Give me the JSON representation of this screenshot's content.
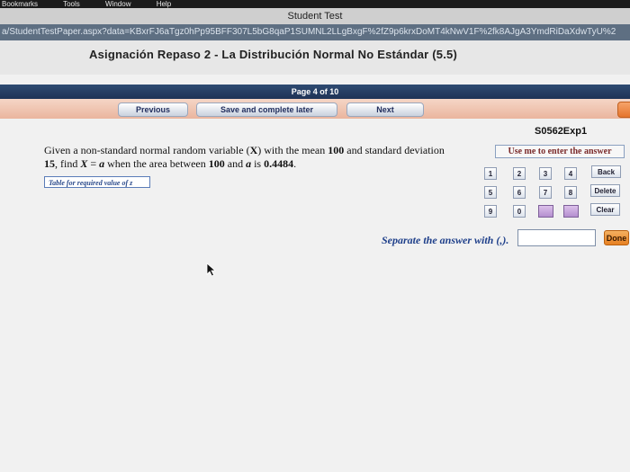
{
  "menubar": {
    "items": [
      "Bookmarks",
      "Tools",
      "Window",
      "Help"
    ]
  },
  "window": {
    "title": "Student Test"
  },
  "url": {
    "text": "a/StudentTestPaper.aspx?data=KBxrFJ6aTgz0hPp95BFF307L5bG8qaP1SUMNL2LLgBxgF%2fZ9p6krxDoMT4kNwV1F%2fk8AJgA3YmdRiDaXdwTyU%2"
  },
  "assignment": {
    "title": "Asignación Repaso 2 - La Distribución Normal No Estándar (5.5)"
  },
  "pager": {
    "label": "Page 4 of 10"
  },
  "nav": {
    "previous": "Previous",
    "save_later": "Save and complete later",
    "next": "Next"
  },
  "question": {
    "id": "S0562Exp1",
    "p1": "Given a non-standard normal random variable (",
    "var_x": "X",
    "p2": ") with the mean ",
    "mean": "100",
    "p3": " and standard deviation ",
    "sd": "15",
    "p4": ", find ",
    "eq_x": "X",
    "eq": " = ",
    "eq_a": "a",
    "p5": " when the area between ",
    "lower": "100",
    "p6": " and ",
    "var_a": "a",
    "p7": " is ",
    "area": "0.4484",
    "p8": ".",
    "table_link": "Table for required value of z"
  },
  "keypad": {
    "header": "Use me to enter the answer",
    "row1": [
      "1",
      "2",
      "3",
      "4"
    ],
    "row2": [
      "5",
      "6",
      "7",
      "8"
    ],
    "row3": [
      "9",
      "0"
    ],
    "back": "Back",
    "delete": "Delete",
    "clear": "Clear"
  },
  "answer": {
    "label": "Separate the answer with (,).",
    "value": "",
    "done": "Done"
  },
  "colors": {
    "pager_bar": "#24395e",
    "nav_row": "#eab59e",
    "done_button": "#e78022",
    "special_key": "#b48fcf"
  }
}
